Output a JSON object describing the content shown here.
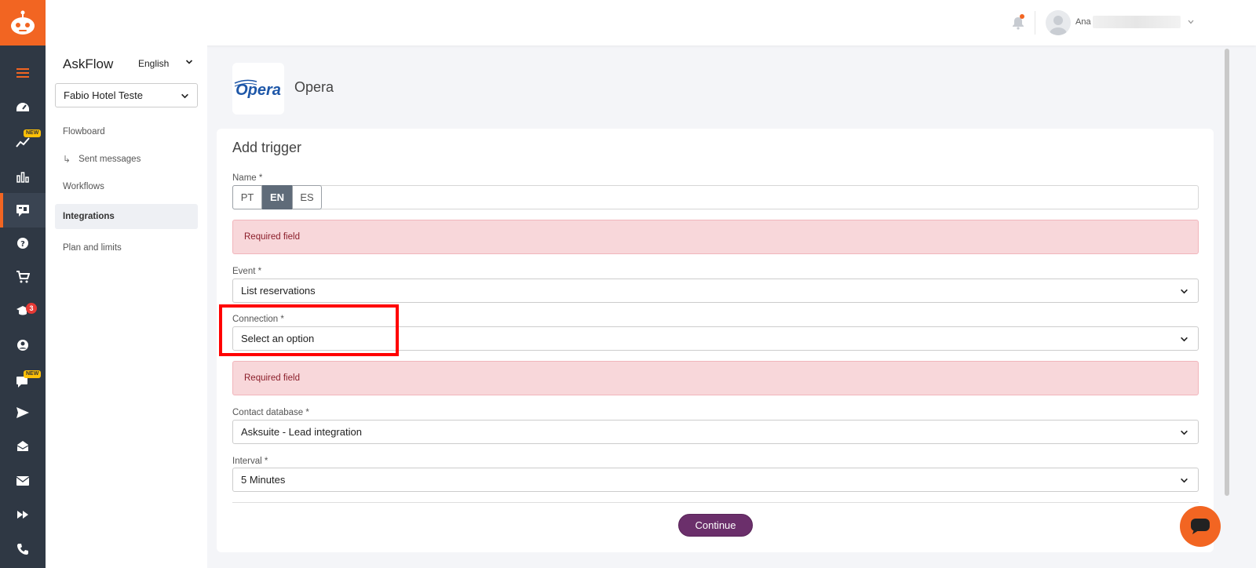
{
  "colors": {
    "accent": "#f26522",
    "rail": "#2f3844",
    "primary_button": "#6b2f6b",
    "error_bg": "#f8d7da",
    "highlight": "#ff0000"
  },
  "rail": {
    "icons": [
      "robot-logo-icon",
      "menu-icon",
      "dashboard-icon",
      "analytics-new-icon",
      "bar-chart-icon",
      "integrations-chat-icon",
      "help-icon",
      "cart-icon",
      "academy-icon",
      "user-icon",
      "chat-new-icon",
      "send-icon",
      "inbox-icon",
      "mail-icon",
      "fast-forward-icon",
      "phone-icon"
    ],
    "new_badge": "NEW",
    "academy_count": "3"
  },
  "topbar": {
    "user_name": "Ana"
  },
  "sidebar": {
    "brand": "AskFlow",
    "language": "English",
    "hotel": "Fabio Hotel Teste",
    "items": [
      {
        "label": "Flowboard"
      },
      {
        "label": "Sent messages",
        "arrow": "↳"
      },
      {
        "label": "Workflows"
      },
      {
        "label": "Integrations"
      },
      {
        "label": "Plan and limits"
      }
    ]
  },
  "integration": {
    "logo_text": "Opera",
    "name": "Opera"
  },
  "form": {
    "title": "Add trigger",
    "name": {
      "label": "Name *",
      "tabs": [
        "PT",
        "EN",
        "ES"
      ],
      "active_tab": "EN",
      "error": "Required field"
    },
    "event": {
      "label": "Event *",
      "value": "List reservations"
    },
    "connection": {
      "label": "Connection *",
      "value": "Select an option",
      "error": "Required field"
    },
    "contact_database": {
      "label": "Contact database *",
      "value": "Asksuite - Lead integration"
    },
    "interval": {
      "label": "Interval *",
      "value": "5 Minutes"
    },
    "continue_label": "Continue"
  }
}
